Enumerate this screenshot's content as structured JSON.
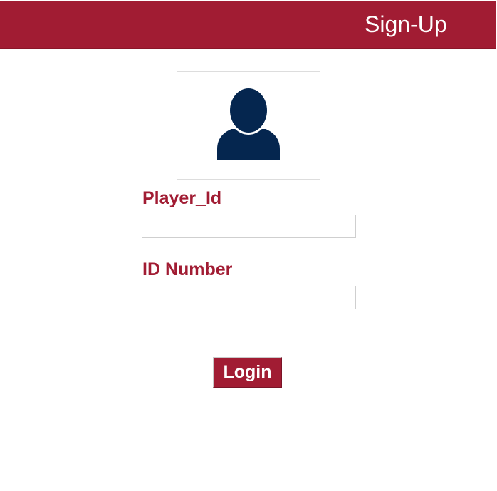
{
  "header": {
    "title": "Sign-Up"
  },
  "avatar": {
    "icon": "user-silhouette-icon",
    "color": "#05264f"
  },
  "form": {
    "player_id": {
      "label": "Player_Id",
      "value": "",
      "placeholder": ""
    },
    "id_number": {
      "label": "ID Number",
      "value": "",
      "placeholder": ""
    },
    "login_label": "Login"
  },
  "colors": {
    "accent": "#a11c33",
    "avatar": "#05264f",
    "background": "#ffffff"
  }
}
